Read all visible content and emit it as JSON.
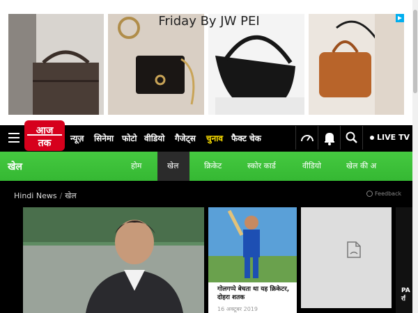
{
  "ad": {
    "title": "Friday By JW PEI"
  },
  "nav": {
    "logo_text": "आज तक",
    "items": [
      "न्यूज़",
      "सिनेमा",
      "फोटो",
      "वीडियो",
      "गैजेट्स",
      "चुनाव",
      "फैक्ट चेक"
    ],
    "active_item": "चुनाव",
    "live_tv": "LIVE TV",
    "accent_color": "#ffe100",
    "logo_color": "#d6001c"
  },
  "section": {
    "title": "खेल",
    "items": [
      "होम",
      "खेल",
      "क्रिकेट",
      "स्कोर कार्ड",
      "वीडियो",
      "खेल की अ"
    ],
    "active_item": "खेल",
    "bar_color": "#3ac43a"
  },
  "breadcrumb": {
    "home": "Hindi News",
    "sep": "/",
    "current": "खेल"
  },
  "feedback": "Feedback",
  "cards": {
    "second": {
      "headline": "गोलगप्पे बेचता था यह क्रिकेटर, दोहरा शतक",
      "date": "16 अक्टूबर 2019"
    },
    "fourth": {
      "text_line1": "PA",
      "text_line2": "र्रा"
    }
  }
}
